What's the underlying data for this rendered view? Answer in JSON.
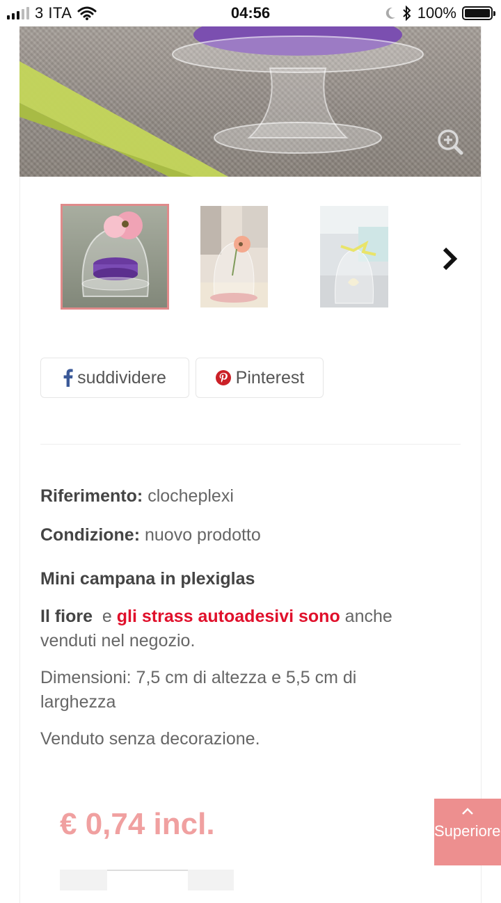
{
  "status_bar": {
    "carrier": "3 ITA",
    "time": "04:56",
    "battery": "100%",
    "battery_level": 1.0
  },
  "gallery": {
    "zoom_icon": "zoom-in-icon",
    "next_icon": "chevron-right-icon",
    "thumbnails": [
      {
        "name": "thumbnail-1",
        "active": true
      },
      {
        "name": "thumbnail-2",
        "active": false
      },
      {
        "name": "thumbnail-3",
        "active": false
      }
    ]
  },
  "share": {
    "facebook": {
      "icon": "facebook-icon",
      "label": "suddividere"
    },
    "pinterest": {
      "icon": "pinterest-icon",
      "label": "Pinterest"
    }
  },
  "details": {
    "reference_label": "Riferimento:",
    "reference_value": "clocheplexi",
    "condition_label": "Condizione:",
    "condition_value": "nuovo prodotto",
    "title": "Mini campana in plexiglas",
    "flower_text": "Il fiore",
    "and_text": "e",
    "strass_text": "gli strass autoadesivi sono",
    "also_sold_line1": "anche",
    "also_sold_line2": "venduti nel negozio.",
    "dimensions_line1": "Dimensioni: 7,5 cm di altezza e 5,5 cm di",
    "dimensions_line2": "larghezza",
    "sold_without": "Venduto senza decorazione."
  },
  "price": "€ 0,74 incl.",
  "back_to_top": {
    "icon": "chevron-up-icon",
    "label": "Superiore"
  },
  "colors": {
    "accent": "#ed8f8f",
    "price": "#f0a0a0",
    "highlight_red": "#e0102b",
    "facebook": "#3b5998",
    "pinterest": "#cb2027"
  }
}
